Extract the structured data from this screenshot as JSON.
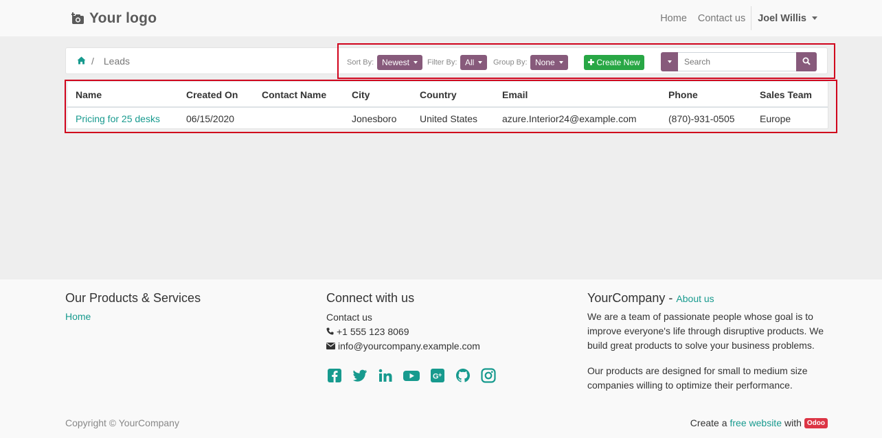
{
  "navbar": {
    "logo_text": "Your logo",
    "links": [
      "Home",
      "Contact us"
    ],
    "user_name": "Joel Willis"
  },
  "breadcrumb": {
    "current": "Leads",
    "separator": "/"
  },
  "toolbar": {
    "sort_label": "Sort By:",
    "sort_value": "Newest",
    "filter_label": "Filter By:",
    "filter_value": "All",
    "group_label": "Group By:",
    "group_value": "None",
    "create_label": "Create New",
    "search_placeholder": "Search"
  },
  "table": {
    "headers": [
      "Name",
      "Created On",
      "Contact Name",
      "City",
      "Country",
      "Email",
      "Phone",
      "Sales Team"
    ],
    "rows": [
      [
        "Pricing for 25 desks",
        "06/15/2020",
        "",
        "Jonesboro",
        "United States",
        "azure.Interior24@example.com",
        "(870)-931-0505",
        "Europe"
      ]
    ]
  },
  "footer": {
    "col1_title": "Our Products & Services",
    "col1_link": "Home",
    "col2_title": "Connect with us",
    "col2_link": "Contact us",
    "phone": "+1 555 123 8069",
    "email": "info@yourcompany.example.com",
    "social_icons": [
      "facebook-icon",
      "twitter-icon",
      "linkedin-icon",
      "youtube-icon",
      "google-plus-icon",
      "github-icon",
      "instagram-icon"
    ],
    "col3_title": "YourCompany",
    "col3_dash": " - ",
    "col3_link": "About us",
    "about_p1": "We are a team of passionate people whose goal is to improve everyone's life through disruptive products. We build great products to solve your business problems.",
    "about_p2": "Our products are designed for small to medium size companies willing to optimize their performance.",
    "copyright": "Copyright © YourCompany",
    "powered_prefix": "Create a",
    "powered_link": "free website",
    "powered_mid": "with",
    "powered_badge": "Odoo"
  },
  "colors": {
    "primary": "#875a7b",
    "link": "#179a8e",
    "success": "#28a745",
    "highlight": "#d0021b",
    "badge": "#dc3545"
  }
}
